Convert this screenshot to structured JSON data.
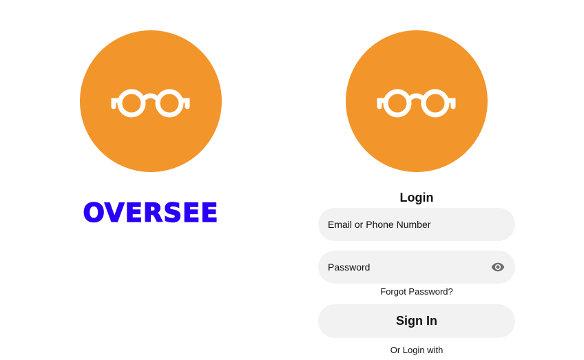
{
  "splash": {
    "brand_name": "OVERSEE",
    "logo_icon": "glasses-icon"
  },
  "login": {
    "logo_icon": "glasses-icon",
    "heading": "Login",
    "email_placeholder": "Email or Phone Number",
    "password_placeholder": "Password",
    "password_toggle_icon": "eye-icon",
    "forgot_password": "Forgot Password?",
    "sign_in_label": "Sign In",
    "alt_login_text": "Or Login with"
  },
  "colors": {
    "brand_orange": "#F2952B",
    "brand_blue": "#2800F7",
    "field_background": "#F2F2F2",
    "text": "#111111"
  }
}
